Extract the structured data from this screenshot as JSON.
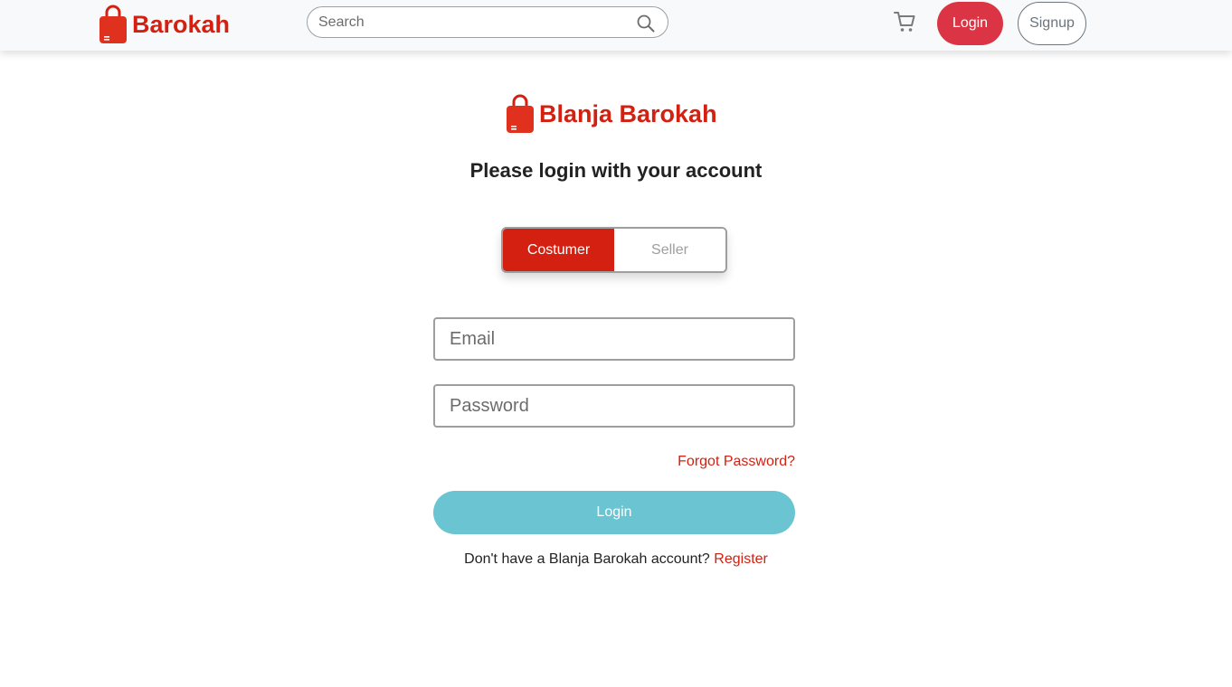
{
  "navbar": {
    "brand": "Barokah",
    "search_placeholder": "Search",
    "login_label": "Login",
    "signup_label": "Signup"
  },
  "login": {
    "logo_text": "Blanja Barokah",
    "heading": "Please login with your account",
    "roles": [
      {
        "label": "Costumer",
        "active": true
      },
      {
        "label": "Seller",
        "active": false
      }
    ],
    "email_placeholder": "Email",
    "password_placeholder": "Password",
    "forgot_label": "Forgot Password?",
    "submit_label": "Login",
    "register_prompt": "Don't have a Blanja Barokah account?",
    "register_label": "Register"
  },
  "icons": {
    "brand": "shopping-bag-icon",
    "search": "search-icon",
    "cart": "cart-icon"
  },
  "colors": {
    "brand_red": "#d32011",
    "nav_login": "#db3545",
    "submit": "#6ac4d2",
    "navbar_bg": "#f8f9fa"
  }
}
